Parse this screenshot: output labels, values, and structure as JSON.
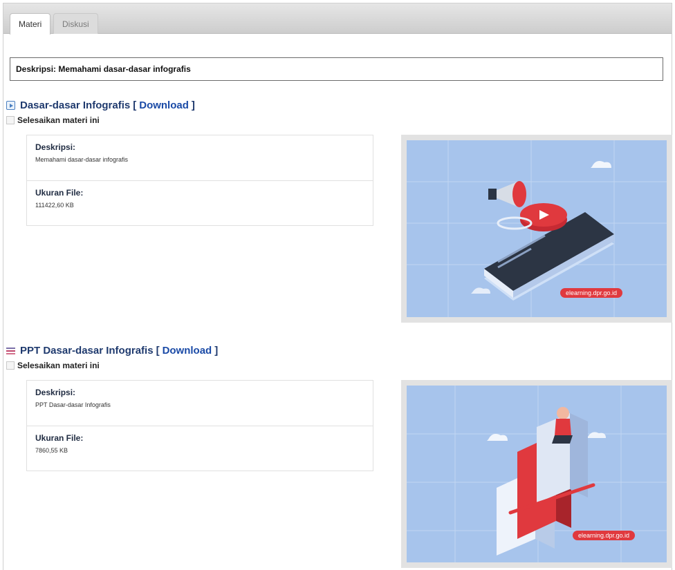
{
  "tabs": [
    {
      "label": "Materi",
      "active": true
    },
    {
      "label": "Diskusi",
      "active": false
    }
  ],
  "description_bar": "Deskripsi: Memahami dasar-dasar infografis",
  "materials": [
    {
      "icon": "video-icon",
      "title": "Dasar-dasar Infografis",
      "download_label": "Download",
      "complete_label": "Selesaikan materi ini",
      "desc_label": "Deskripsi:",
      "desc_value": "Memahami dasar-dasar infografis",
      "size_label": "Ukuran File:",
      "size_value": "111422,60 KB",
      "thumb_watermark": "elearning.dpr.go.id"
    },
    {
      "icon": "ppt-icon",
      "title": "PPT Dasar-dasar Infografis",
      "download_label": "Download",
      "complete_label": "Selesaikan materi ini",
      "desc_label": "Deskripsi:",
      "desc_value": "PPT Dasar-dasar Infografis",
      "size_label": "Ukuran File:",
      "size_value": "7860,55 KB",
      "thumb_watermark": "elearning.dpr.go.id"
    }
  ],
  "colors": {
    "accent": "#1a4aa6",
    "thumb_bg": "#a7c4ec",
    "watermark": "#e0393e"
  }
}
